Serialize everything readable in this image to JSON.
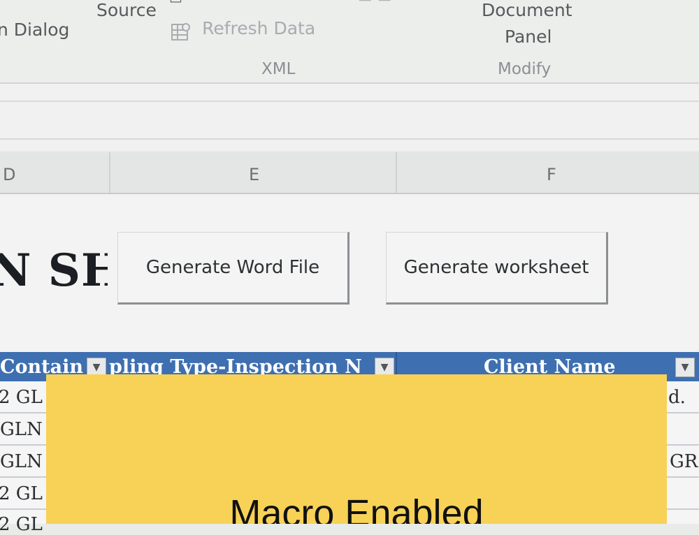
{
  "ribbon": {
    "items": [
      {
        "label": "Source"
      },
      {
        "label": "n Dialog"
      },
      {
        "label": "Refresh Data"
      },
      {
        "label": "Document"
      },
      {
        "label": "Panel"
      }
    ],
    "groups": [
      {
        "label": "XML"
      },
      {
        "label": "Modify"
      }
    ]
  },
  "columns": [
    {
      "letter": "D"
    },
    {
      "letter": "E"
    },
    {
      "letter": "F"
    }
  ],
  "sheet": {
    "title_partial": "N SH",
    "buttons": [
      {
        "label": "Generate Word File"
      },
      {
        "label": "Generate worksheet"
      }
    ]
  },
  "table": {
    "headers": [
      {
        "label": "Contain"
      },
      {
        "label": "pling Type-Inspection N"
      },
      {
        "label": "Client Name"
      }
    ],
    "rows": [
      {
        "left": "2 GL",
        "right": "d."
      },
      {
        "left": "GLN",
        "right": ""
      },
      {
        "left": "GLN",
        "right": "GR"
      },
      {
        "left": "2 GL",
        "right": ""
      },
      {
        "left": "2 GL",
        "right": ""
      }
    ]
  },
  "overlay": {
    "text": "Macro Enabled",
    "color": "#f7d257"
  }
}
